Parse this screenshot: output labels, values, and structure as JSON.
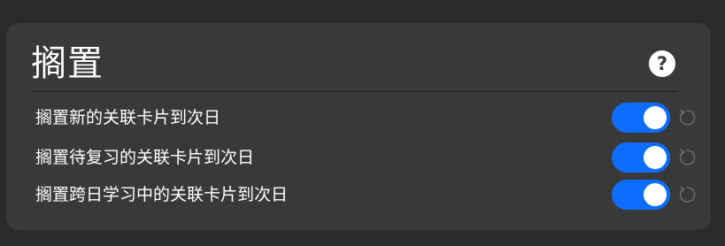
{
  "section": {
    "title": "搁置",
    "help_icon": "question-circle-icon"
  },
  "settings": [
    {
      "label": "搁置新的关联卡片到次日",
      "enabled": true,
      "reset_icon": "reset-icon"
    },
    {
      "label": "搁置待复习的关联卡片到次日",
      "enabled": true,
      "reset_icon": "reset-icon"
    },
    {
      "label": "搁置跨日学习中的关联卡片到次日",
      "enabled": true,
      "reset_icon": "reset-icon"
    }
  ],
  "colors": {
    "page_bg": "#2a2a2a",
    "panel_bg": "#393939",
    "toggle_on": "#0d6efd",
    "text": "#ffffff",
    "reset_icon": "#6a6a6a"
  }
}
